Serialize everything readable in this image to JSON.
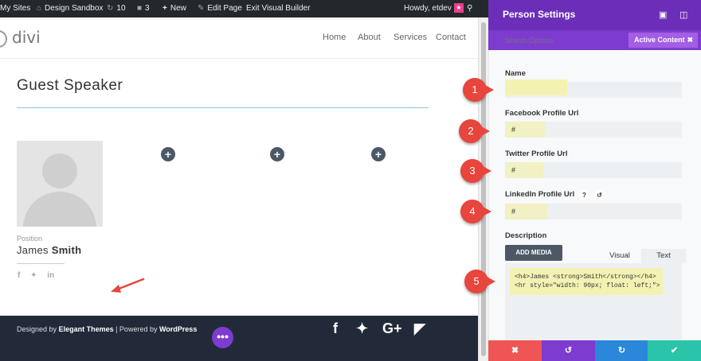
{
  "admin_bar": {
    "my_sites": "My Sites",
    "site_name": "Design Sandbox",
    "updates_count": "10",
    "comments_count": "3",
    "new_label": "New",
    "edit_page": "Edit Page",
    "exit_builder": "Exit Visual Builder",
    "greeting": "Howdy, etdev"
  },
  "site": {
    "logo": "divi",
    "nav": [
      "Home",
      "About",
      "Services",
      "Contact"
    ]
  },
  "page": {
    "title": "Guest Speaker",
    "person": {
      "position": "Position",
      "first_name": "James",
      "last_name": "Smith",
      "social_icons": [
        "facebook-icon",
        "twitter-icon",
        "linkedin-icon"
      ]
    }
  },
  "footer": {
    "designed_by": "Designed by",
    "theme_author": "Elegant Themes",
    "separator": " | Powered by ",
    "platform": "WordPress",
    "more_button": "•••",
    "social_icons": [
      "f",
      "t",
      "G+",
      "rss"
    ]
  },
  "panel": {
    "title": "Person Settings",
    "search_placeholder": "Search Options",
    "active_filter": "Active Content",
    "fields": {
      "name_label": "Name",
      "name_value": "",
      "facebook_label": "Facebook Profile Url",
      "facebook_value": "#",
      "twitter_label": "Twitter Profile Url",
      "twitter_value": "#",
      "linkedin_label": "LinkedIn Profile Url",
      "linkedin_value": "#",
      "description_label": "Description"
    },
    "add_media": "ADD MEDIA",
    "tabs": [
      "Visual",
      "Text"
    ],
    "description_code_line1": "<h4>James <strong>Smith</strong></h4>",
    "description_code_line2": "<hr style=\"width: 90px; float: left;\">"
  },
  "markers": [
    "1",
    "2",
    "3",
    "4",
    "5"
  ],
  "colors": {
    "admin_bar": "#23282d",
    "panel_header": "#6c2eb9",
    "panel_subbar": "#7e3bd0",
    "highlight": "#f3f2b3",
    "marker": "#e8453c",
    "footer": "#222a3a",
    "cancel": "#ef5555",
    "undo": "#7e3bd0",
    "redo": "#2b87da",
    "save": "#29c4a9"
  }
}
